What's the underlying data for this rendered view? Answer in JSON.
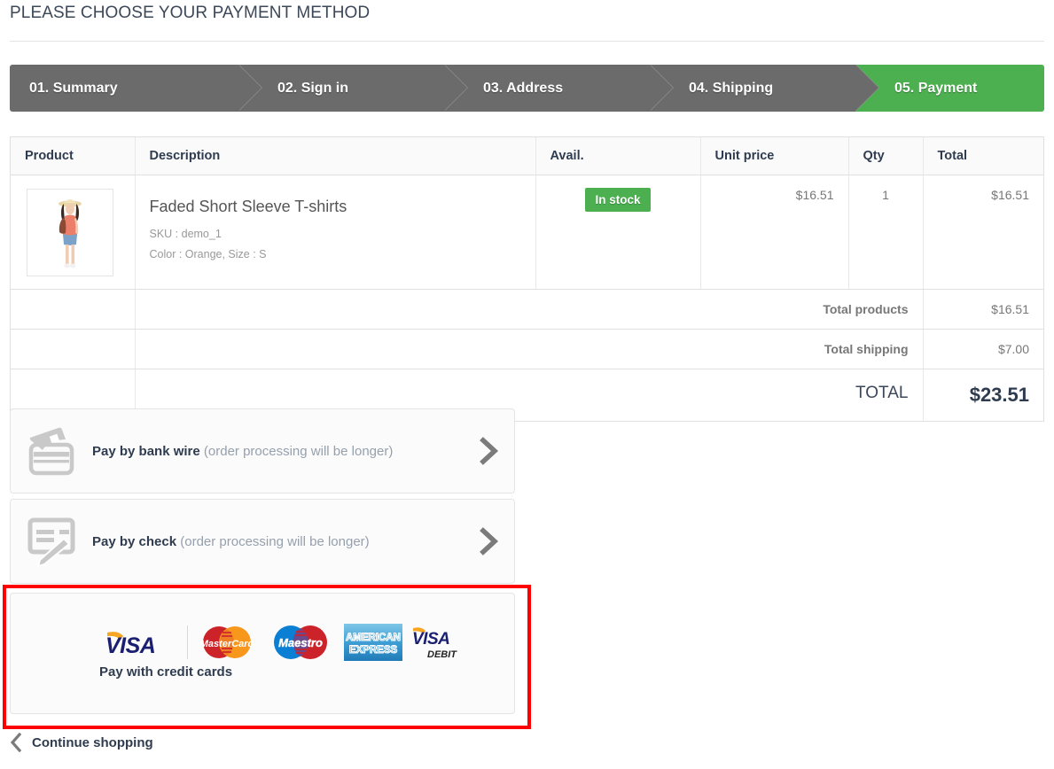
{
  "page": {
    "title": "PLEASE CHOOSE YOUR PAYMENT METHOD"
  },
  "colors": {
    "step_inactive": "#6b6b6b",
    "step_active": "#4cb051",
    "in_stock_badge": "#4cb051",
    "highlight_box": "#ff0000",
    "title_text": "#3c4858"
  },
  "steps": [
    {
      "label": "01. Summary",
      "state": "done"
    },
    {
      "label": "02. Sign in",
      "state": "done"
    },
    {
      "label": "03. Address",
      "state": "done"
    },
    {
      "label": "04. Shipping",
      "state": "done"
    },
    {
      "label": "05. Payment",
      "state": "current"
    }
  ],
  "cart": {
    "headers": {
      "product": "Product",
      "description": "Description",
      "avail": "Avail.",
      "unit_price": "Unit price",
      "qty": "Qty",
      "total": "Total"
    },
    "items": [
      {
        "name": "Faded Short Sleeve T-shirts",
        "sku": "SKU : demo_1",
        "attributes": "Color : Orange, Size : S",
        "availability": "In stock",
        "unit_price": "$16.51",
        "qty": "1",
        "total": "$16.51",
        "thumbnail_alt": "woman-in-hat-orange-top-denim-shorts"
      }
    ],
    "summary": [
      {
        "label": "Total products",
        "value": "$16.51"
      },
      {
        "label": "Total shipping",
        "value": "$7.00"
      }
    ],
    "grand_total": {
      "label": "TOTAL",
      "value": "$23.51"
    }
  },
  "payment_options": [
    {
      "id": "bankwire",
      "title": "Pay by bank wire",
      "note": " (order processing will be longer)",
      "icon": "two-credit-cards-icon",
      "chevron": "chevron-right-icon"
    },
    {
      "id": "check",
      "title": "Pay by check",
      "note": " (order processing will be longer)",
      "icon": "check-with-pen-icon",
      "chevron": "chevron-right-icon"
    }
  ],
  "credit_card": {
    "label": "Pay with credit cards",
    "logos": [
      {
        "name": "visa-logo",
        "text": "VISA"
      },
      {
        "name": "mastercard-logo",
        "text": "MasterCard"
      },
      {
        "name": "maestro-logo",
        "text": "Maestro"
      },
      {
        "name": "american-express-logo",
        "text": "AMERICAN EXPRESS"
      },
      {
        "name": "visa-debit-logo",
        "text": "VISA",
        "subtext": "DEBIT"
      }
    ]
  },
  "footer": {
    "continue_shopping": "Continue shopping",
    "chevron": "chevron-left-icon"
  }
}
